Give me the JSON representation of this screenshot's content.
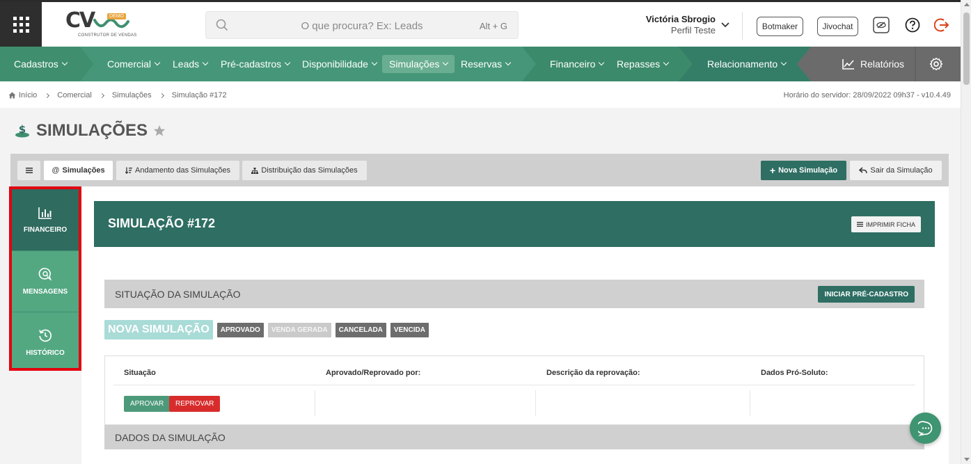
{
  "header": {
    "logo_text": "CV",
    "logo_tag": "DEMO",
    "logo_sub": "CONSTRUTOR DE VENDAS",
    "search_placeholder": "O que procura? Ex: Leads",
    "search_shortcut": "Alt + G",
    "user_name": "Victória Sbrogio",
    "user_role": "Perfil Teste",
    "botmaker_label": "Botmaker",
    "jivochat_label": "Jivochat"
  },
  "nav": {
    "items": [
      {
        "label": "Cadastros"
      },
      {
        "label": "Comercial"
      },
      {
        "label": "Leads"
      },
      {
        "label": "Pré-cadastros"
      },
      {
        "label": "Disponibilidade"
      },
      {
        "label": "Simulações"
      },
      {
        "label": "Reservas"
      },
      {
        "label": "Financeiro"
      },
      {
        "label": "Repasses"
      },
      {
        "label": "Relacionamento"
      }
    ],
    "reports_label": "Relatórios",
    "colors": {
      "primary": "#3f8f6f",
      "dark": "#2e6e63",
      "gray": "#6b6b6b"
    }
  },
  "breadcrumb": {
    "items": [
      "Início",
      "Comercial",
      "Simulações",
      "Simulação #172"
    ],
    "server_time": "Horário do servidor: 28/09/2022 09h37 - v10.4.49"
  },
  "page": {
    "title": "SIMULAÇÕES"
  },
  "tabs": {
    "menu_icon": "hamburger-icon",
    "items": [
      {
        "label": "Simulações",
        "prefix": "@"
      },
      {
        "label": "Andamento das Simulações"
      },
      {
        "label": "Distribuição das Simulações"
      }
    ],
    "new_label": "Nova Simulação",
    "exit_label": "Sair da Simulação"
  },
  "side_menu": {
    "items": [
      {
        "label": "FINANCEIRO",
        "icon": "bar-chart-icon"
      },
      {
        "label": "MENSAGENS",
        "icon": "chat-search-icon"
      },
      {
        "label": "HISTÓRICO",
        "icon": "history-icon"
      }
    ],
    "highlight_color": "#e3000f"
  },
  "simulation": {
    "title": "SIMULAÇÃO #172",
    "print_label": "IMPRIMIR FICHA",
    "status_section": "SITUAÇÃO DA SIMULAÇÃO",
    "start_label": "INICIAR PRÉ-CADASTRO",
    "statuses": [
      "NOVA SIMULAÇÃO",
      "APROVADO",
      "VENDA GERADA",
      "CANCELADA",
      "VENCIDA"
    ],
    "table": {
      "headers": [
        "Situação",
        "Aprovado/Reprovado por:",
        "Descrição da reprovação:",
        "Dados Pró-Soluto:"
      ],
      "approve_label": "APROVAR",
      "reject_label": "REPROVAR"
    },
    "data_section": "DADOS DA SIMULAÇÃO"
  }
}
